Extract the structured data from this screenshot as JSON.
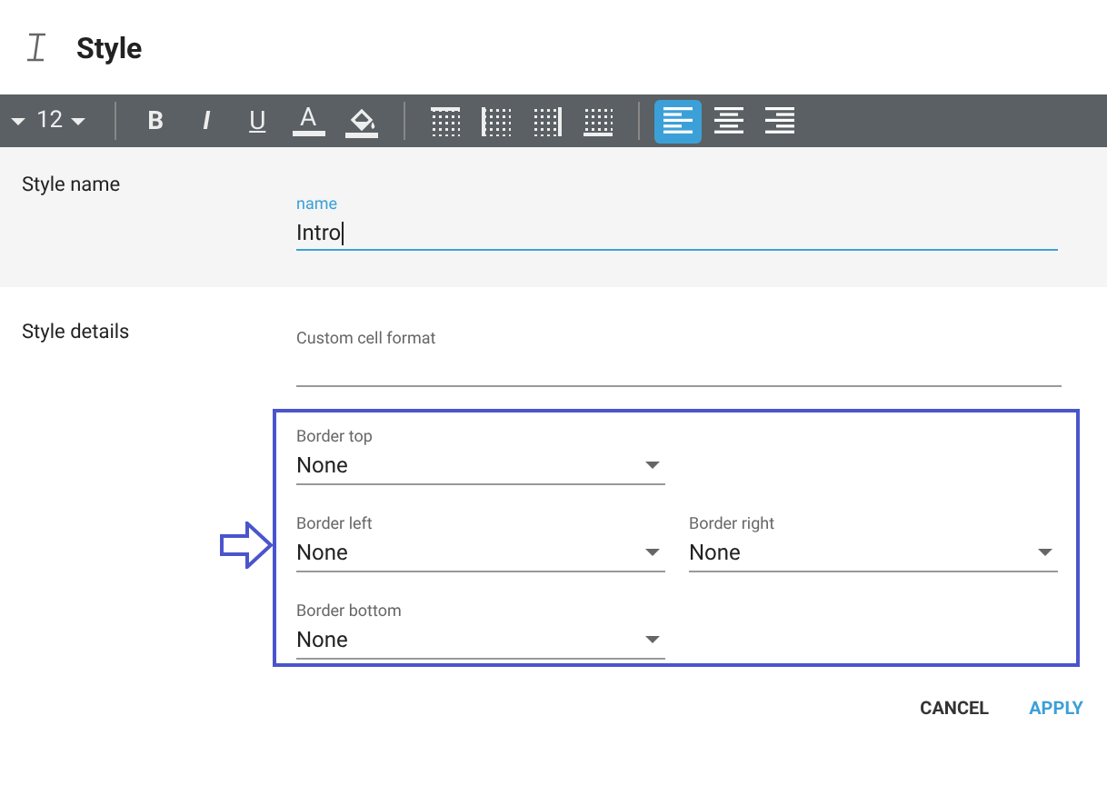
{
  "dialog": {
    "title": "Style"
  },
  "toolbar": {
    "font_size": "12",
    "text_buttons": [
      {
        "kind": "bold",
        "label": "B"
      },
      {
        "kind": "italic",
        "label": "I"
      },
      {
        "kind": "underline",
        "label": "U"
      },
      {
        "kind": "color",
        "label": "A"
      }
    ],
    "border_buttons": [
      {
        "kind": "top"
      },
      {
        "kind": "left"
      },
      {
        "kind": "right"
      },
      {
        "kind": "bottom"
      }
    ],
    "align_buttons": [
      {
        "kind": "left",
        "selected": true
      },
      {
        "kind": "center",
        "selected": false
      },
      {
        "kind": "right",
        "selected": false
      }
    ]
  },
  "style_name": {
    "label": "Style name",
    "field_label": "name",
    "value": "Intro"
  },
  "style_details": {
    "label": "Style details",
    "custom_format": {
      "placeholder": "Custom cell format"
    },
    "borders": [
      {
        "label": "Border top",
        "value": "None"
      },
      {
        "label": "Border left",
        "value": "None"
      },
      {
        "label": "Border right",
        "value": "None"
      },
      {
        "label": "Border bottom",
        "value": "None"
      }
    ]
  },
  "buttons": [
    {
      "label": "CANCEL",
      "kind": "plain"
    },
    {
      "label": "APPLY",
      "kind": "primary"
    }
  ]
}
